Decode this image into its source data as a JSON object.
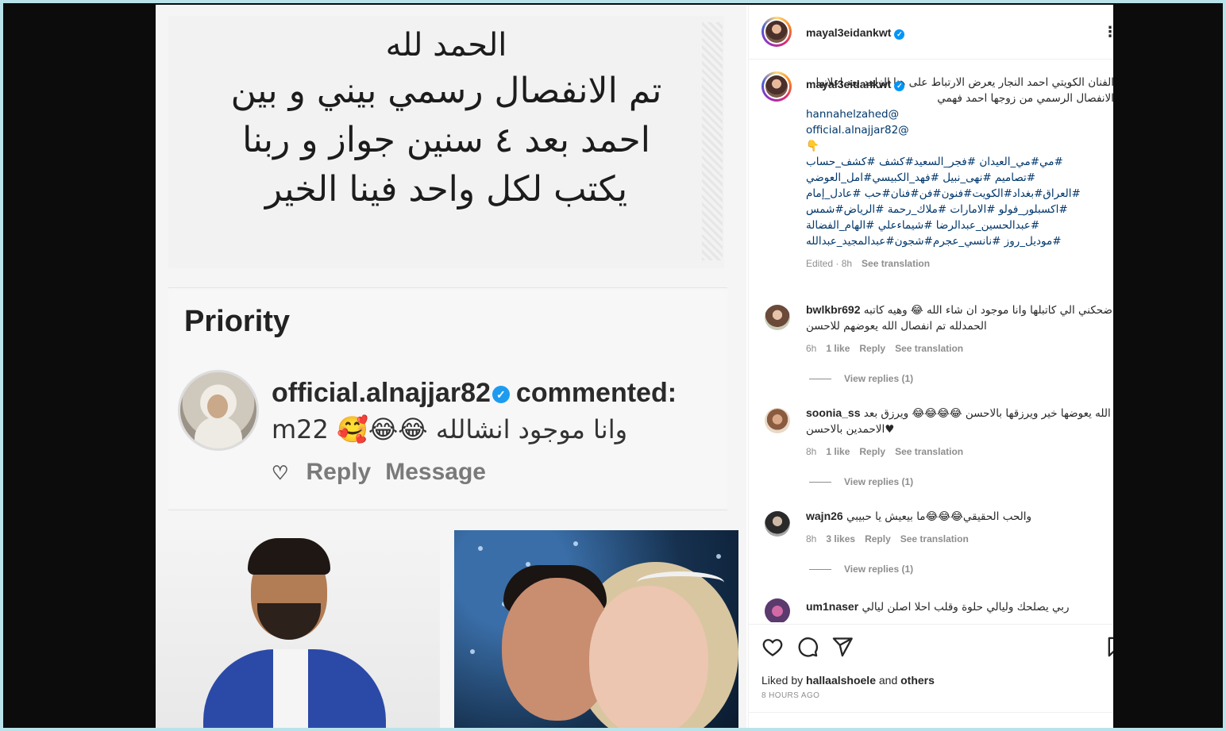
{
  "media": {
    "text_lines": [
      "الحمد لله",
      "تم الانفصال رسمي بيني و بين",
      "احمد بعد ٤ سنين جواز و ربنا",
      "يكتب لكل واحد فينا الخير"
    ],
    "priority_label": "Priority",
    "notif_username": "official.alnajjar82",
    "notif_action": "commented:",
    "notif_comment": "mوانا موجود انشالله 😂😂🥰 22",
    "reply_label": "Reply",
    "message_label": "Message"
  },
  "panel": {
    "header_username": "mayal3eidankwt",
    "more_icon": "⋮",
    "caption": {
      "username": "mayal3eidankwt",
      "text": "الفنان الكويتي احمد النجار يعرض الارتباط على هنا الزاهد بعد اعلانها الانفصال الرسمي من زوجها احمد فهمي",
      "mention1": "hannahelzahed@",
      "mention2": "official.alnajjar82@",
      "emoji": "👇",
      "hashtags": [
        "#مي#مي_العيدان #فجر_السعيد#كشف #كشف_حساب",
        "#تصاميم #نهى_نبيل #فهد_الكبيسي#امل_العوضي",
        "#العراق#بغداد#الكويت#فنون#فن#فنان#حب #عادل_إمام",
        "#اكسبلور_فولو #الامارات #ملاك_رحمة #الرياض#شمس",
        "#عبدالحسين_عبدالرضا #شيماءعلي #الهام_الفضالة",
        "#موديل_روز #نانسي_عجرم#شجون#عبدالمجيد_عبدالله"
      ],
      "edited": "Edited · 8h",
      "see_translation": "See translation"
    },
    "comments": [
      {
        "username": "bwlkbr692",
        "text": "ضحكني الي كاتبلها وانا موجود ان شاء الله 😂 وهيه كاتبه الحمدلله تم انفصال الله يعوضهم للاحسن",
        "time": "6h",
        "likes": "1 like",
        "reply": "Reply",
        "see_translation": "See translation",
        "view_replies": "View replies (1)"
      },
      {
        "username": "soonia_ss",
        "text": "الله يعوضها خير ويرزقها بالاحسن 😂😂😂😂 ويرزق بعد الاحمدين بالاحسن♥",
        "time": "8h",
        "likes": "1 like",
        "reply": "Reply",
        "see_translation": "See translation",
        "view_replies": "View replies (1)"
      },
      {
        "username": "wajn26",
        "text": "والحب الحقيقي😂😂😂ما بيعيش يا حبيبي",
        "time": "8h",
        "likes": "3 likes",
        "reply": "Reply",
        "see_translation": "See translation",
        "view_replies": "View replies (1)"
      },
      {
        "username": "um1naser",
        "text": "ربي يصلحك وليالي حلوة وقلب احلا اصلن ليالي",
        "time": "",
        "likes": "",
        "reply": "",
        "see_translation": "",
        "view_replies": ""
      }
    ],
    "liked_prefix": "Liked by",
    "liked_user": "hallaalshoele",
    "liked_and": "and",
    "liked_others": "others",
    "time_ago": "8 HOURS AGO"
  }
}
